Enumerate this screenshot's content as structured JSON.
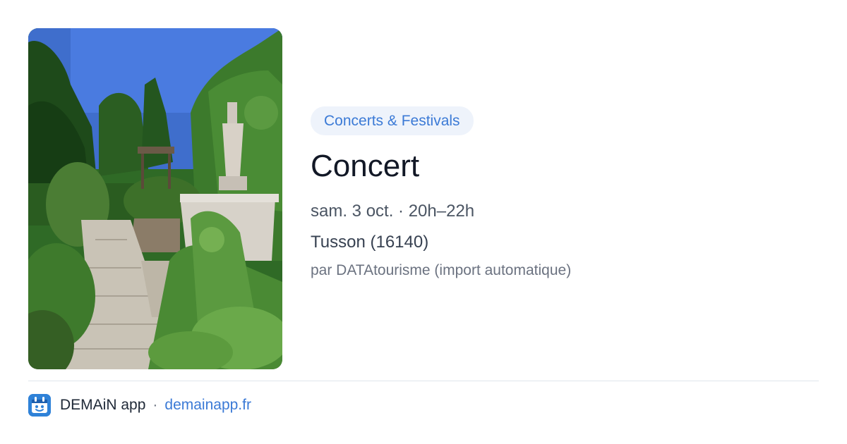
{
  "event": {
    "category": "Concerts & Festivals",
    "title": "Concert",
    "when": "sam. 3 oct. · 20h–22h",
    "where": "Tusson (16140)",
    "source": "par DATAtourisme (import automatique)"
  },
  "photo": {
    "subject": "garden with stone path, hedges and a stone statue under blue sky"
  },
  "footer": {
    "app_name": "DEMAiN app",
    "separator": "·",
    "website": "demainapp.fr"
  },
  "colors": {
    "accent": "#3b7ad6",
    "category_bg": "#eef3fb",
    "app_icon_bg": "#2f82d8"
  },
  "icons": {
    "app_logo": "demain-app-logo-icon"
  }
}
